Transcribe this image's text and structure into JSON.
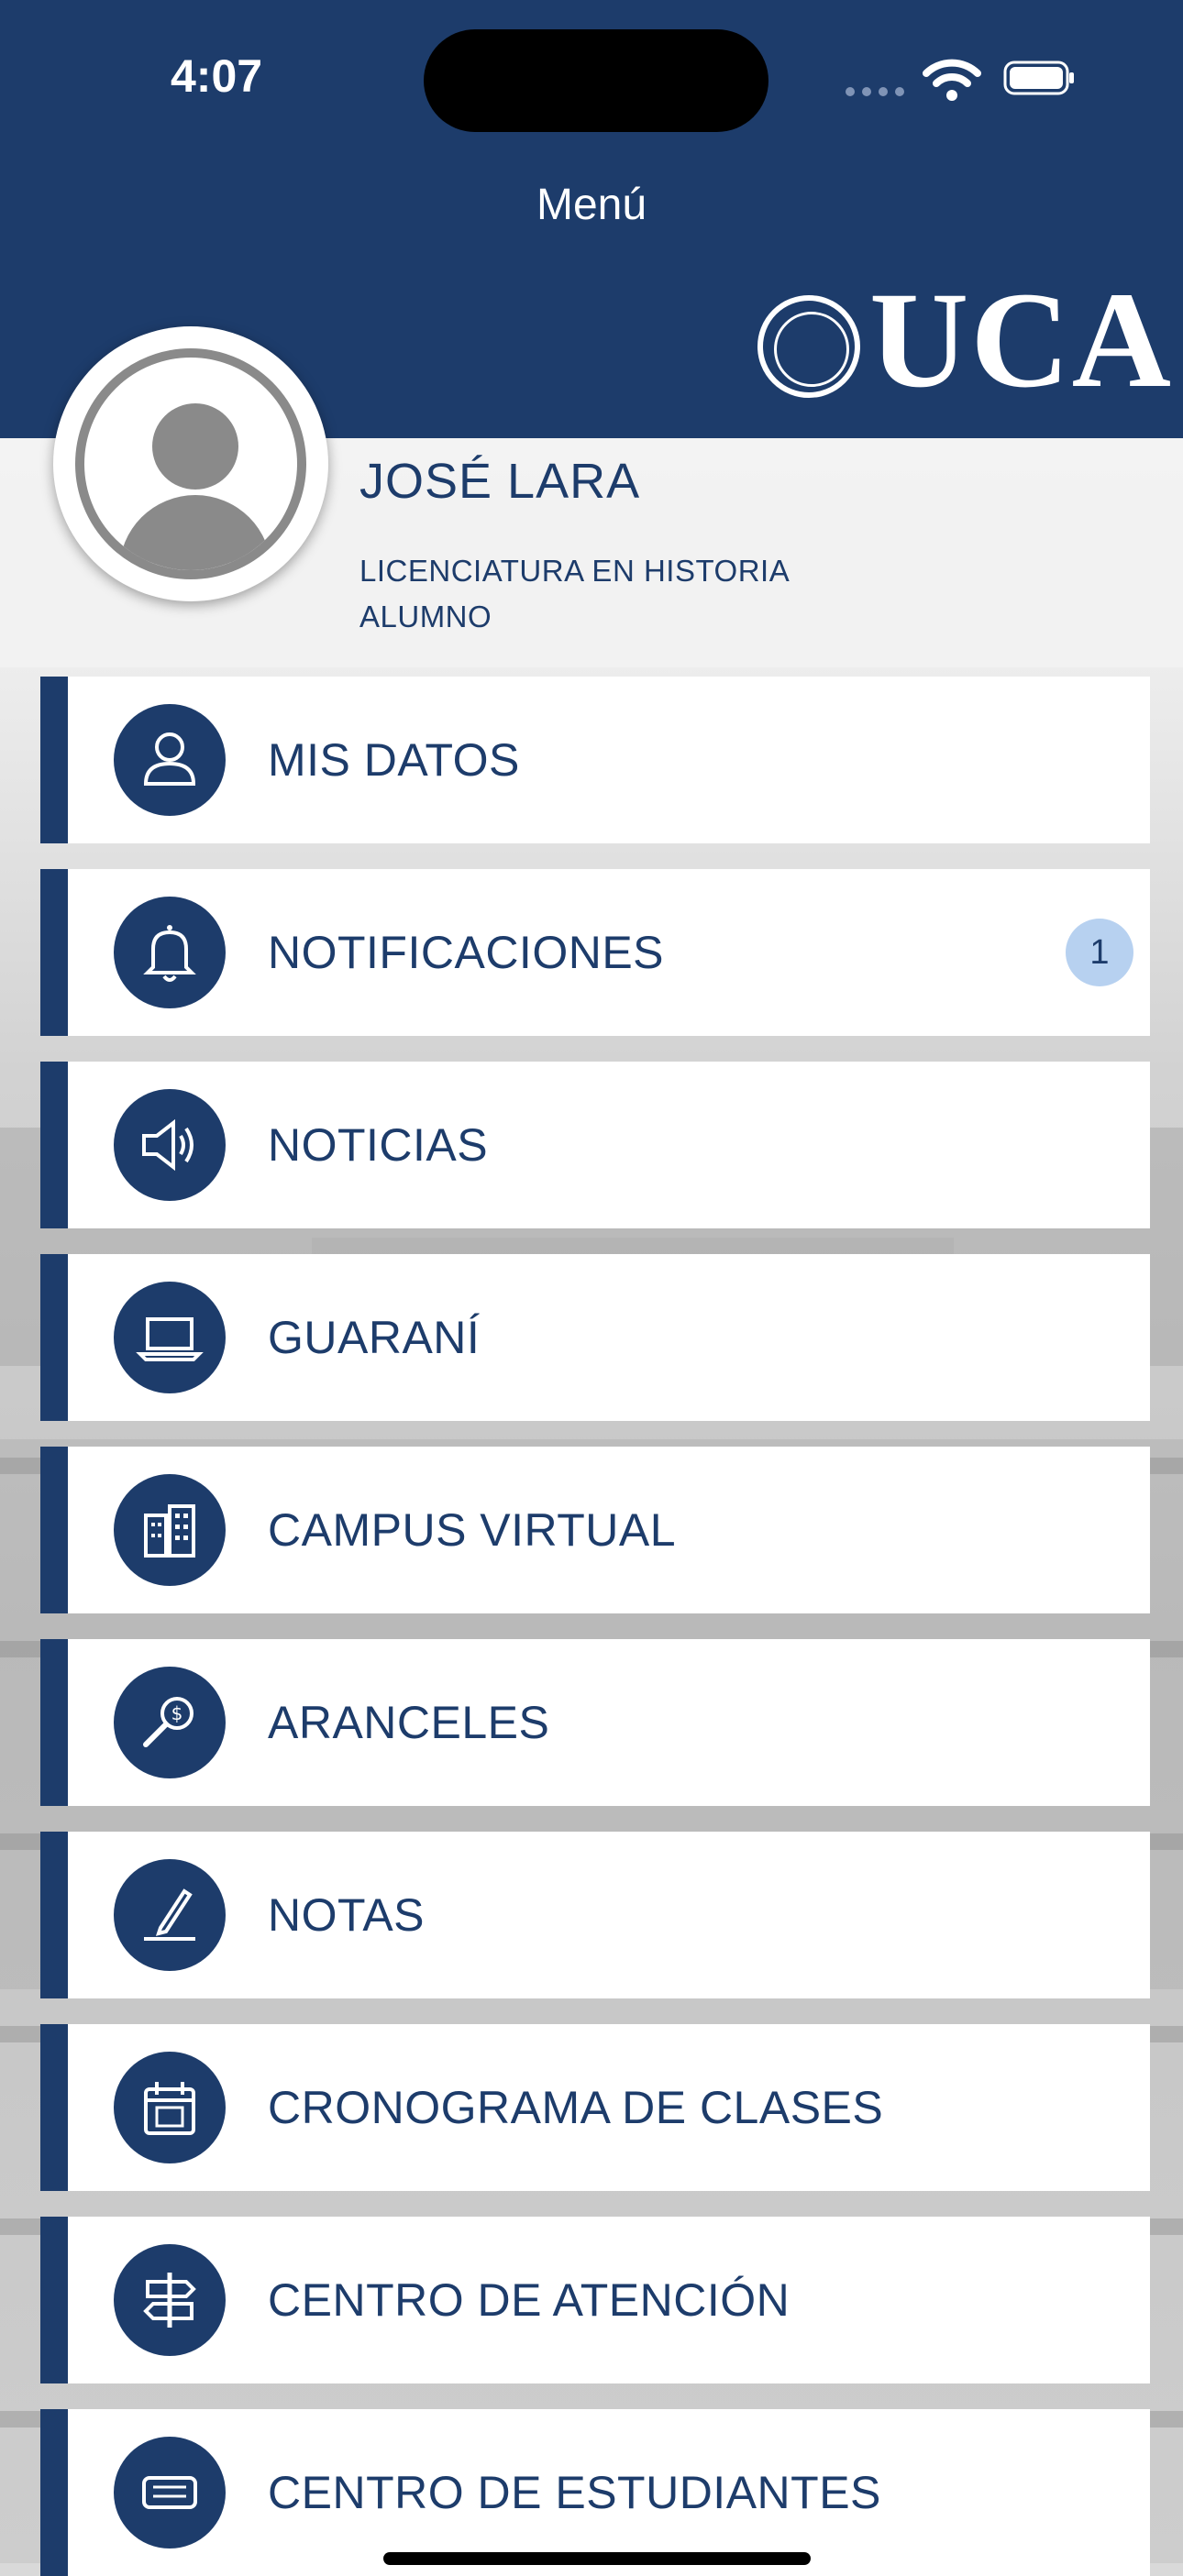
{
  "status_bar": {
    "time": "4:07"
  },
  "header": {
    "title": "Menú",
    "logo_text": "UCA"
  },
  "profile": {
    "name": "JOSÉ LARA",
    "career": "LICENCIATURA EN HISTORIA",
    "role": "ALUMNO"
  },
  "menu": {
    "items": [
      {
        "label": "MIS DATOS",
        "icon": "user-icon"
      },
      {
        "label": "NOTIFICACIONES",
        "icon": "bell-icon",
        "badge": "1"
      },
      {
        "label": "NOTICIAS",
        "icon": "megaphone-icon"
      },
      {
        "label": "GUARANÍ",
        "icon": "laptop-icon"
      },
      {
        "label": "CAMPUS VIRTUAL",
        "icon": "building-icon"
      },
      {
        "label": "ARANCELES",
        "icon": "money-search-icon"
      },
      {
        "label": "NOTAS",
        "icon": "pen-icon"
      },
      {
        "label": "CRONOGRAMA DE CLASES",
        "icon": "calendar-icon"
      },
      {
        "label": "CENTRO DE ATENCIÓN",
        "icon": "signpost-icon"
      },
      {
        "label": "CENTRO DE ESTUDIANTES",
        "icon": "diploma-icon"
      }
    ]
  },
  "colors": {
    "primary": "#1d3c6b",
    "badge": "#b7d1f0",
    "card": "#ffffff"
  }
}
